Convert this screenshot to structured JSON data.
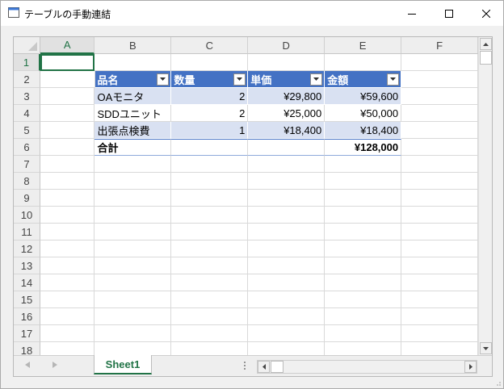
{
  "window": {
    "title": "テーブルの手動連結",
    "icon": "app-window-icon",
    "controls": [
      "minimize-icon",
      "maximize-icon",
      "close-icon"
    ]
  },
  "sheet": {
    "column_headers": [
      "A",
      "B",
      "C",
      "D",
      "E",
      "F"
    ],
    "row_headers": [
      "1",
      "2",
      "3",
      "4",
      "5",
      "6",
      "7",
      "8",
      "9",
      "10",
      "11",
      "12",
      "13",
      "14",
      "15",
      "16",
      "17",
      "18"
    ],
    "active_cell": "A1",
    "active_column": "A",
    "active_row": "1",
    "table": {
      "headers": [
        "品名",
        "数量",
        "単価",
        "金額"
      ],
      "rows": [
        [
          "OAモニタ",
          "2",
          "¥29,800",
          "¥59,600"
        ],
        [
          "SDDユニット",
          "2",
          "¥25,000",
          "¥50,000"
        ],
        [
          "出張点検費",
          "1",
          "¥18,400",
          "¥18,400"
        ]
      ],
      "total": {
        "label": "合計",
        "quantity": "",
        "unit_price": "",
        "amount": "¥128,000"
      },
      "colors": {
        "header_bg": "#4472c4",
        "band_bg": "#d9e1f2",
        "header_text": "#ffffff"
      }
    },
    "tabs": [
      "Sheet1"
    ],
    "active_tab": "Sheet1",
    "accent_color": "#217346"
  }
}
